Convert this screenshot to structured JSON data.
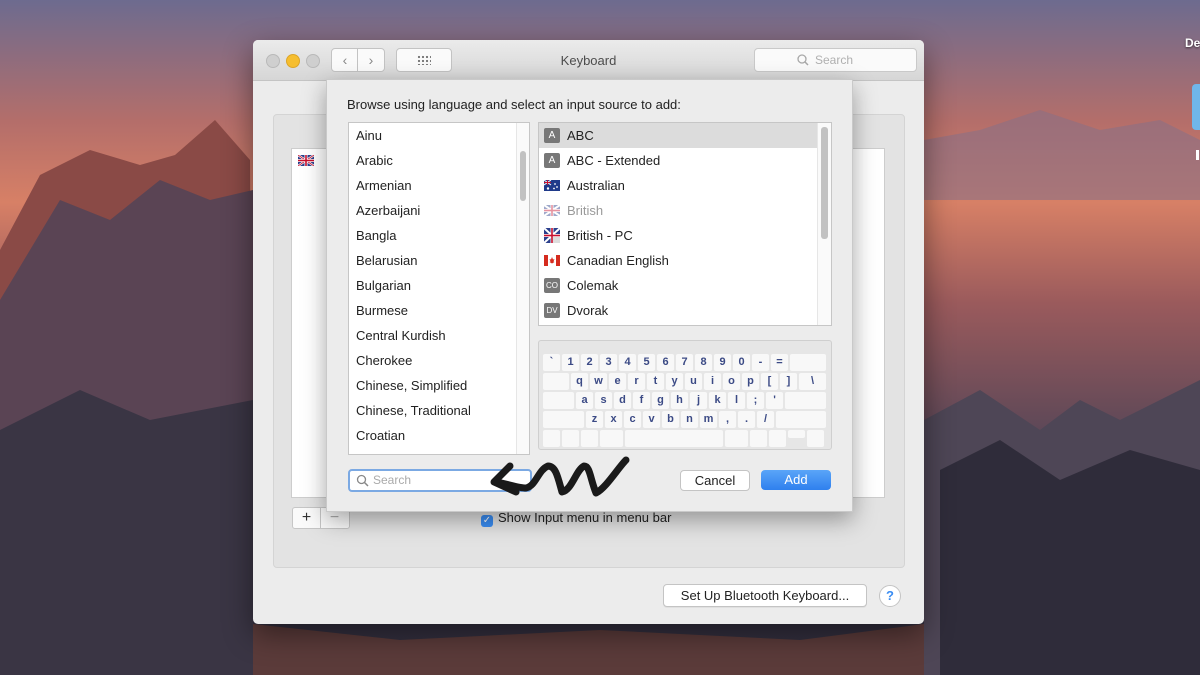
{
  "desktop": {
    "label": "De"
  },
  "window": {
    "title": "Keyboard",
    "search_placeholder": "Search",
    "show_input_menu_label": "Show Input menu in menu bar",
    "bluetooth_button": "Set Up Bluetooth Keyboard...",
    "help_glyph": "?",
    "plus_glyph": "+",
    "minus_glyph": "−",
    "nav_back_glyph": "‹",
    "nav_forward_glyph": "›"
  },
  "sheet": {
    "instruction": "Browse using language and select an input source to add:",
    "languages": [
      "Ainu",
      "Arabic",
      "Armenian",
      "Azerbaijani",
      "Bangla",
      "Belarusian",
      "Bulgarian",
      "Burmese",
      "Central Kurdish",
      "Cherokee",
      "Chinese, Simplified",
      "Chinese, Traditional",
      "Croatian"
    ],
    "sources": [
      {
        "label": "ABC",
        "icon": "a-badge-icon",
        "badge": "A",
        "selected": true
      },
      {
        "label": "ABC - Extended",
        "icon": "a-badge-icon",
        "badge": "A"
      },
      {
        "label": "Australian",
        "icon": "australia-flag-icon"
      },
      {
        "label": "British",
        "icon": "uk-flag-icon",
        "disabled": true
      },
      {
        "label": "British - PC",
        "icon": "uk-flag-icon"
      },
      {
        "label": "Canadian English",
        "icon": "canada-flag-icon"
      },
      {
        "label": "Colemak",
        "icon": "co-badge-icon",
        "badge": "CO"
      },
      {
        "label": "Dvorak",
        "icon": "dv-badge-icon",
        "badge": "DV"
      }
    ],
    "keyboard_rows": [
      [
        "`",
        "1",
        "2",
        "3",
        "4",
        "5",
        "6",
        "7",
        "8",
        "9",
        "0",
        "-",
        "="
      ],
      [
        "q",
        "w",
        "e",
        "r",
        "t",
        "y",
        "u",
        "i",
        "o",
        "p",
        "[",
        "]",
        "\\"
      ],
      [
        "a",
        "s",
        "d",
        "f",
        "g",
        "h",
        "j",
        "k",
        "l",
        ";",
        "'"
      ],
      [
        "z",
        "x",
        "c",
        "v",
        "b",
        "n",
        "m",
        ",",
        ".",
        "/"
      ]
    ],
    "search_placeholder": "Search",
    "cancel_label": "Cancel",
    "add_label": "Add"
  },
  "colors": {
    "accent": "#3a8df3",
    "key_text": "#3b4a85",
    "annotation_arrow": "#1a1a1a"
  }
}
